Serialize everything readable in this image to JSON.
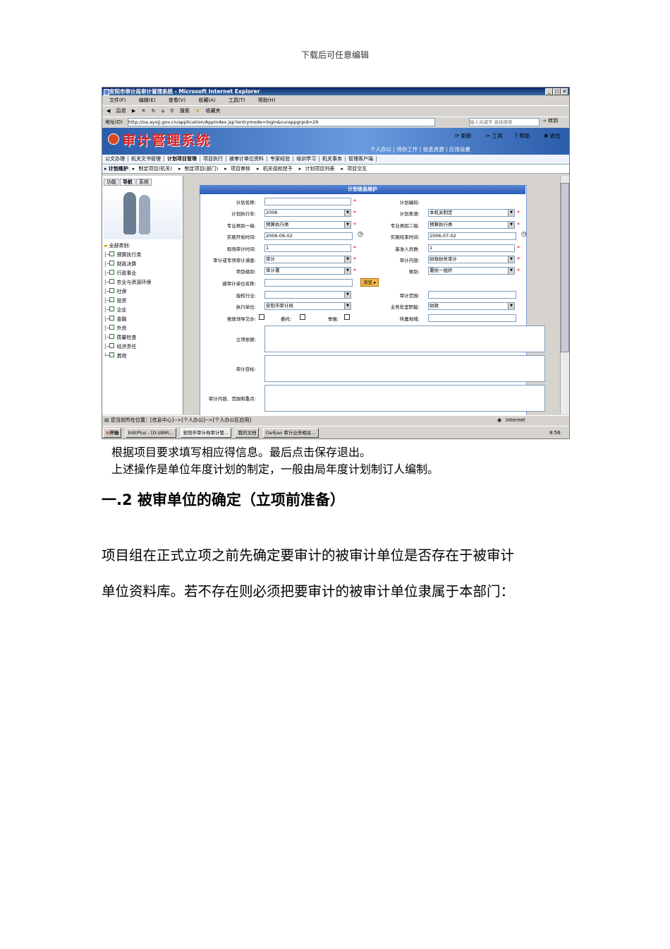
{
  "header_note": "下载后可任意编辑",
  "browser": {
    "window_title": "安阳市审计局审计管理系统 - Microsoft Internet Explorer",
    "menu": [
      "文件(F)",
      "编辑(E)",
      "查看(V)",
      "收藏(A)",
      "工具(T)",
      "帮助(H)"
    ],
    "toolbar": [
      "后退",
      "搜索",
      "收藏夹"
    ],
    "address_label": "地址(D)",
    "address_url": "http://oa.ayxjj.gov.cn/application/AppIndex.jsp?entrymode=login&curappgrpid=29",
    "search_placeholder": "输入关键字  直接搜索",
    "go_label": "转到"
  },
  "app": {
    "logo_text": "审计管理系统",
    "top_links": [
      "刷新",
      "工具",
      "帮助",
      "退出"
    ],
    "nav2": "个人办公 | 待办工作 | 信息资源 | 应用设置",
    "modules": [
      "公文办理",
      "机关文书管理",
      "计划项目管理",
      "项目执行",
      "被审计单位资料",
      "专家经验",
      "培训学习",
      "机关事务",
      "管理客户端"
    ],
    "subtabs": [
      "计划维护",
      "制定项目(机关)",
      "制定项目(部门)",
      "项目审核",
      "机关阅权授予",
      "计划项目列表",
      "项目交互"
    ],
    "left_tabs": [
      "功能",
      "导航",
      "系统"
    ],
    "tree_root": "全部类别:",
    "tree_items": [
      "预算执行类",
      "财政决算",
      "行政事业",
      "农业与资源环保",
      "社保",
      "投资",
      "企业",
      "金融",
      "外资",
      "质量检查",
      "经济责任",
      "其他"
    ]
  },
  "form": {
    "title": "计划信息维护",
    "plan_name_label": "计划名称:",
    "plan_code_label": "计划编码:",
    "exec_year_label": "计划执行年:",
    "exec_year_value": "2006",
    "source_label": "计划来源:",
    "source_value": "本机关制定",
    "cat1_label": "专业类别一级:",
    "cat1_value": "预算执行类",
    "cat2_label": "专业类别二级:",
    "cat2_value": "预算执行类",
    "start_label": "实施开始时间:",
    "start_value": "2006-06-02",
    "end_label": "实施结束时间:",
    "end_value": "2006-07-02",
    "onsite_label": "现场审计时间:",
    "onsite_value": "1",
    "staff_label": "基准人员数:",
    "staff_value": "1",
    "type_label": "审计或专项审计调查:",
    "type_value": "审计",
    "content_label": "审计内容:",
    "content_value": "财政财务审计",
    "level_label": "项目级别:",
    "level_value": "审计署",
    "category_label": "类别:",
    "category_value": "署统一组织",
    "auditee_label": "被审计单位名称:",
    "browse_label": "浏览",
    "industry_label": "授权行业:",
    "scope_label": "审计范围:",
    "unit_label": "执行单位:",
    "unit_value": "安阳市审计局",
    "dept_label": "业务处室职能:",
    "dept_value": "财政",
    "leader_label": "党政领导交办:",
    "entrust_label": "委托:",
    "report_label": "举报:",
    "region_label": "所属地域:",
    "basis_label": "立项依据:",
    "goal_label": "审计目标:",
    "focus_label": "审计内容、范围和重点:"
  },
  "statusbar": {
    "location": "您当前所在位置：[信息中心]-->[个人办公]-->[个人办公区应用]",
    "zone": "Internet"
  },
  "taskbar": {
    "start": "开始",
    "items": [
      "EditPlus - [D:\\IBM\\...",
      "安阳市审计局审计管...",
      "我的文档",
      "Oa与ao 审计业务相关..."
    ],
    "clock": "8:56"
  },
  "body": {
    "line1": "根据项目要求填写相应得信息。最后点击保存退出。",
    "line2": "上述操作是单位年度计划的制定，一般由局年度计划制订人编制。",
    "heading": "一.2 被审单位的确定（立项前准备）",
    "para_line1": "项目组在正式立项之前先确定要审计的被审计单位是否存在于被审计",
    "para_line2": "单位资料库。若不存在则必须把要审计的被审计单位隶属于本部门："
  }
}
